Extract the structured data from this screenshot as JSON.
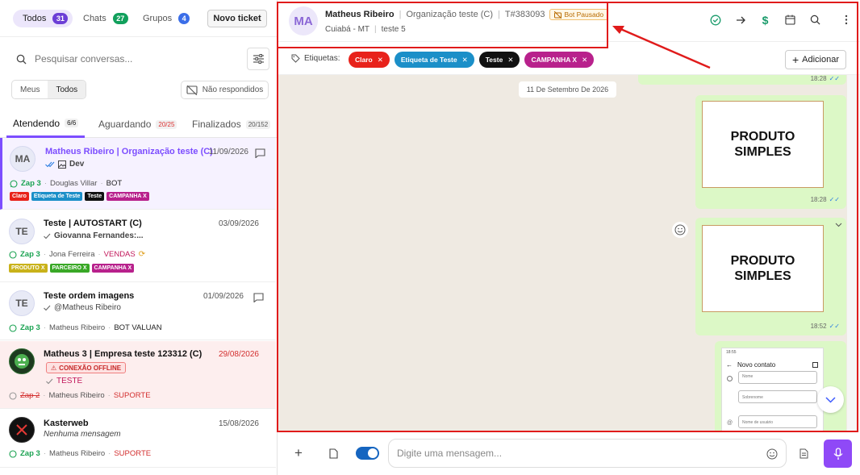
{
  "colors": {
    "accent": "#7c4dff",
    "annotation": "#e01b1b",
    "green": "#1aa251",
    "chat_bg": "#efeae2",
    "bubble": "#dcf8c6"
  },
  "left": {
    "filters": [
      {
        "label": "Todos",
        "count": "31",
        "color": "#6c3fd6"
      },
      {
        "label": "Chats",
        "count": "27",
        "color": "#11a05c"
      },
      {
        "label": "Grupos",
        "count": "4",
        "color": "#3b6ee8"
      }
    ],
    "new_ticket": "Novo ticket",
    "search_placeholder": "Pesquisar conversas...",
    "scope": {
      "mine": "Meus",
      "all": "Todos"
    },
    "unanswered": "Não respondidos",
    "tabs": [
      {
        "label": "Atendendo",
        "count": "6/6"
      },
      {
        "label": "Aguardando",
        "count": "20/25"
      },
      {
        "label": "Finalizados",
        "count": "20/152"
      }
    ],
    "tickets": [
      {
        "initials": "MA",
        "name": "Matheus Ribeiro | Organização teste (C)",
        "date": "11/09/2026",
        "last_msg": "Dev",
        "conn": "Zap 3",
        "agent": "Douglas Villar",
        "queue": "BOT",
        "tags": [
          {
            "t": "Claro",
            "c": "#e8221b"
          },
          {
            "t": "Etiqueta de Teste",
            "c": "#1b8fc8"
          },
          {
            "t": "Teste",
            "c": "#111111"
          },
          {
            "t": "CAMPANHA X",
            "c": "#b8218c"
          }
        ]
      },
      {
        "initials": "TE",
        "name": "Teste | AUTOSTART (C)",
        "date": "03/09/2026",
        "last_msg": "Giovanna Fernandes:...",
        "conn": "Zap 3",
        "agent": "Jona Ferreira",
        "queue": "VENDAS",
        "tags": [
          {
            "t": "PRODUTO X",
            "c": "#c9b21a"
          },
          {
            "t": "PARCEIRO X",
            "c": "#39a826"
          },
          {
            "t": "CAMPANHA X",
            "c": "#b8218c"
          }
        ]
      },
      {
        "initials": "TE",
        "name": "Teste ordem imagens",
        "date": "01/09/2026",
        "last_msg": "@Matheus Ribeiro",
        "conn": "Zap 3",
        "agent": "Matheus Ribeiro",
        "queue": "BOT VALUAN"
      },
      {
        "name": "Matheus 3 | Empresa teste 123312 (C)",
        "date": "29/08/2026",
        "offline": "CONEXÃO OFFLINE",
        "last_msg": "TESTE",
        "conn": "Zap 2",
        "agent": "Matheus Ribeiro",
        "queue": "SUPORTE"
      },
      {
        "name": "Kasterweb",
        "date": "15/08/2026",
        "last_msg": "Nenhuma mensagem",
        "conn": "Zap 3",
        "agent": "Matheus Ribeiro",
        "queue": "SUPORTE"
      }
    ]
  },
  "header": {
    "initials": "MA",
    "name": "Matheus Ribeiro",
    "org": "Organização teste (C)",
    "ticket": "T#383093",
    "bot_status": "Bot Pausado",
    "city": "Cuiabá - MT",
    "queue": "teste 5"
  },
  "etiquetas": {
    "label": "Etiquetas:",
    "tags": [
      {
        "t": "Claro",
        "c": "#e8221b"
      },
      {
        "t": "Etiqueta de Teste",
        "c": "#1b8fc8"
      },
      {
        "t": "Teste",
        "c": "#111111"
      },
      {
        "t": "CAMPANHA X",
        "c": "#b8218c"
      }
    ],
    "add": "Adicionar"
  },
  "chat": {
    "date": "11 De Setembro De 2026",
    "top_time": "18:28",
    "messages": [
      {
        "text": "PRODUTO SIMPLES",
        "time": "18:28"
      },
      {
        "text": "PRODUTO SIMPLES",
        "time": "18:52"
      }
    ],
    "phone": {
      "status_time": "18:55",
      "title": "Novo contato",
      "fields": [
        "Nome",
        "Sobrenome",
        "Nome de usuário"
      ]
    }
  },
  "composer": {
    "placeholder": "Digite uma mensagem..."
  }
}
